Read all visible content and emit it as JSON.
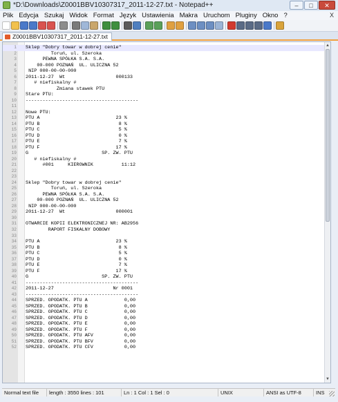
{
  "window": {
    "title": "*D:\\Downloads\\Z0001BBV10307317_2011-12-27.txt - Notepad++",
    "minimize": "–",
    "maximize": "□",
    "close": "✕"
  },
  "menu": {
    "items": [
      "Plik",
      "Edycja",
      "Szukaj",
      "Widok",
      "Format",
      "Język",
      "Ustawienia",
      "Makra",
      "Uruchom",
      "Pluginy",
      "Okno",
      "?"
    ],
    "close_doc": "X"
  },
  "toolbar": {
    "buttons": [
      {
        "icon": "new-file-icon",
        "color": "#ffffff"
      },
      {
        "icon": "open-file-icon",
        "color": "#f2c14e"
      },
      {
        "icon": "save-icon",
        "color": "#4a79c9"
      },
      {
        "icon": "save-all-icon",
        "color": "#4a79c9"
      },
      {
        "icon": "close-icon",
        "color": "#d9534f"
      },
      {
        "icon": "close-all-icon",
        "color": "#d9534f"
      },
      {
        "icon": "print-icon",
        "color": "#8c8c8c"
      },
      {
        "icon": "cut-icon",
        "color": "#7a7a7a"
      },
      {
        "icon": "copy-icon",
        "color": "#9fb7d8"
      },
      {
        "icon": "paste-icon",
        "color": "#c9a66b"
      },
      {
        "icon": "undo-icon",
        "color": "#3f8f3f"
      },
      {
        "icon": "redo-icon",
        "color": "#3f8f3f"
      },
      {
        "icon": "find-icon",
        "color": "#5b5b5b"
      },
      {
        "icon": "replace-icon",
        "color": "#4f7fbf"
      },
      {
        "icon": "zoom-in-icon",
        "color": "#5aa05a"
      },
      {
        "icon": "zoom-out-icon",
        "color": "#5aa05a"
      },
      {
        "icon": "sync-v-icon",
        "color": "#e0a040"
      },
      {
        "icon": "sync-h-icon",
        "color": "#e0a040"
      },
      {
        "icon": "word-wrap-icon",
        "color": "#6d8fc2"
      },
      {
        "icon": "show-all-icon",
        "color": "#6d8fc2"
      },
      {
        "icon": "indent-guide-icon",
        "color": "#6d8fc2"
      },
      {
        "icon": "fold-icon",
        "color": "#9bb4d6"
      },
      {
        "icon": "record-macro-icon",
        "color": "#d23a2e"
      },
      {
        "icon": "stop-macro-icon",
        "color": "#5a6b86"
      },
      {
        "icon": "play-macro-icon",
        "color": "#5a6b86"
      },
      {
        "icon": "run-macro-icon",
        "color": "#5a6b86"
      },
      {
        "icon": "save-macro-icon",
        "color": "#4a79c9"
      },
      {
        "icon": "spellcheck-icon",
        "color": "#d9a33b"
      }
    ]
  },
  "tab": {
    "label": "Z0001BBV10307317_2011-12-27.txt"
  },
  "editor": {
    "lines": [
      {
        "n": "1",
        "t": "Sklep \"Dobry towar w dobrej cenie\""
      },
      {
        "n": "2",
        "t": "         Toruń, ul. Szeroka"
      },
      {
        "n": "3",
        "t": "      PEWNA SPÓŁKA S.A. S.A."
      },
      {
        "n": "4",
        "t": "    00-000 POZNAŃ  UL. ULICZNA 52"
      },
      {
        "n": "5",
        "t": " NIP 000-00-00-000"
      },
      {
        "n": "6",
        "t": "2011-12-27  Wt                  000133"
      },
      {
        "n": "7",
        "t": "   # niefiskalny #"
      },
      {
        "n": "8",
        "t": "           Zmiana stawek PTU"
      },
      {
        "n": "9",
        "t": "Stare PTU:"
      },
      {
        "n": "10",
        "t": "----------------------------------------"
      },
      {
        "n": "11",
        "t": ""
      },
      {
        "n": "12",
        "t": "Nowe PTU:"
      },
      {
        "n": "13",
        "t": "PTU A                           23 %"
      },
      {
        "n": "14",
        "t": "PTU B                            8 %"
      },
      {
        "n": "15",
        "t": "PTU C                            5 %"
      },
      {
        "n": "16",
        "t": "PTU D                            0 %"
      },
      {
        "n": "17",
        "t": "PTU E                            7 %"
      },
      {
        "n": "18",
        "t": "PTU F                           17 %"
      },
      {
        "n": "19",
        "t": "G                          SP. ZW. PTU"
      },
      {
        "n": "20",
        "t": "   # niefiskalny #"
      },
      {
        "n": "21",
        "t": "      #001     KIEROWNIK          11:12"
      },
      {
        "n": "22",
        "t": ""
      },
      {
        "n": "23",
        "t": ""
      },
      {
        "n": "24",
        "t": "Sklep \"Dobry towar w dobrej cenie\""
      },
      {
        "n": "25",
        "t": "         Toruń, ul. Szeroka"
      },
      {
        "n": "26",
        "t": "      PEWNA SPÓŁKA S.A. S.A."
      },
      {
        "n": "27",
        "t": "    00-000 POZNAŃ  UL. ULICZNA 52"
      },
      {
        "n": "28",
        "t": " NIP 000-00-00-000"
      },
      {
        "n": "29",
        "t": "2011-12-27  Wt                  000001"
      },
      {
        "n": "30",
        "t": ""
      },
      {
        "n": "31",
        "t": "OTWARCIE KOPII ELEKTRONICZNEJ NR: AB2956"
      },
      {
        "n": "32",
        "t": "        RAPORT FISKALNY DOBOWY"
      },
      {
        "n": "33",
        "t": ""
      },
      {
        "n": "34",
        "t": "PTU A                           23 %"
      },
      {
        "n": "35",
        "t": "PTU B                            8 %"
      },
      {
        "n": "36",
        "t": "PTU C                            5 %"
      },
      {
        "n": "37",
        "t": "PTU D                            0 %"
      },
      {
        "n": "38",
        "t": "PTU E                            7 %"
      },
      {
        "n": "39",
        "t": "PTU F                           17 %"
      },
      {
        "n": "40",
        "t": "G                          SP. ZW. PTU"
      },
      {
        "n": "41",
        "t": "----------------------------------------"
      },
      {
        "n": "42",
        "t": "2011-12-27                     Nr 0001"
      },
      {
        "n": "43",
        "t": "----------------------------------------"
      },
      {
        "n": "44",
        "t": "SPRZED. OPODATK. PTU A             0,00"
      },
      {
        "n": "45",
        "t": "SPRZED. OPODATK. PTU B             0,00"
      },
      {
        "n": "46",
        "t": "SPRZED. OPODATK. PTU C             0,00"
      },
      {
        "n": "47",
        "t": "SPRZED. OPODATK. PTU D             0,00"
      },
      {
        "n": "48",
        "t": "SPRZED. OPODATK. PTU E             0,00"
      },
      {
        "n": "49",
        "t": "SPRZED. OPODATK. PTU F             0,00"
      },
      {
        "n": "50",
        "t": "SPRZED. OPODATK. PTU AFV           0,00"
      },
      {
        "n": "51",
        "t": "SPRZED. OPODATK. PTU BFV           0,00"
      },
      {
        "n": "52",
        "t": "SPRZED. OPODATK. PTU CFV           0,00"
      }
    ],
    "current_line": "1"
  },
  "status": {
    "file_type": "Normal text file",
    "length_lines": "length : 3550   lines : 101",
    "position": "Ln : 1   Col : 1   Sel : 0",
    "eol": "UNIX",
    "encoding": "ANSI as UTF-8",
    "mode": "INS"
  }
}
